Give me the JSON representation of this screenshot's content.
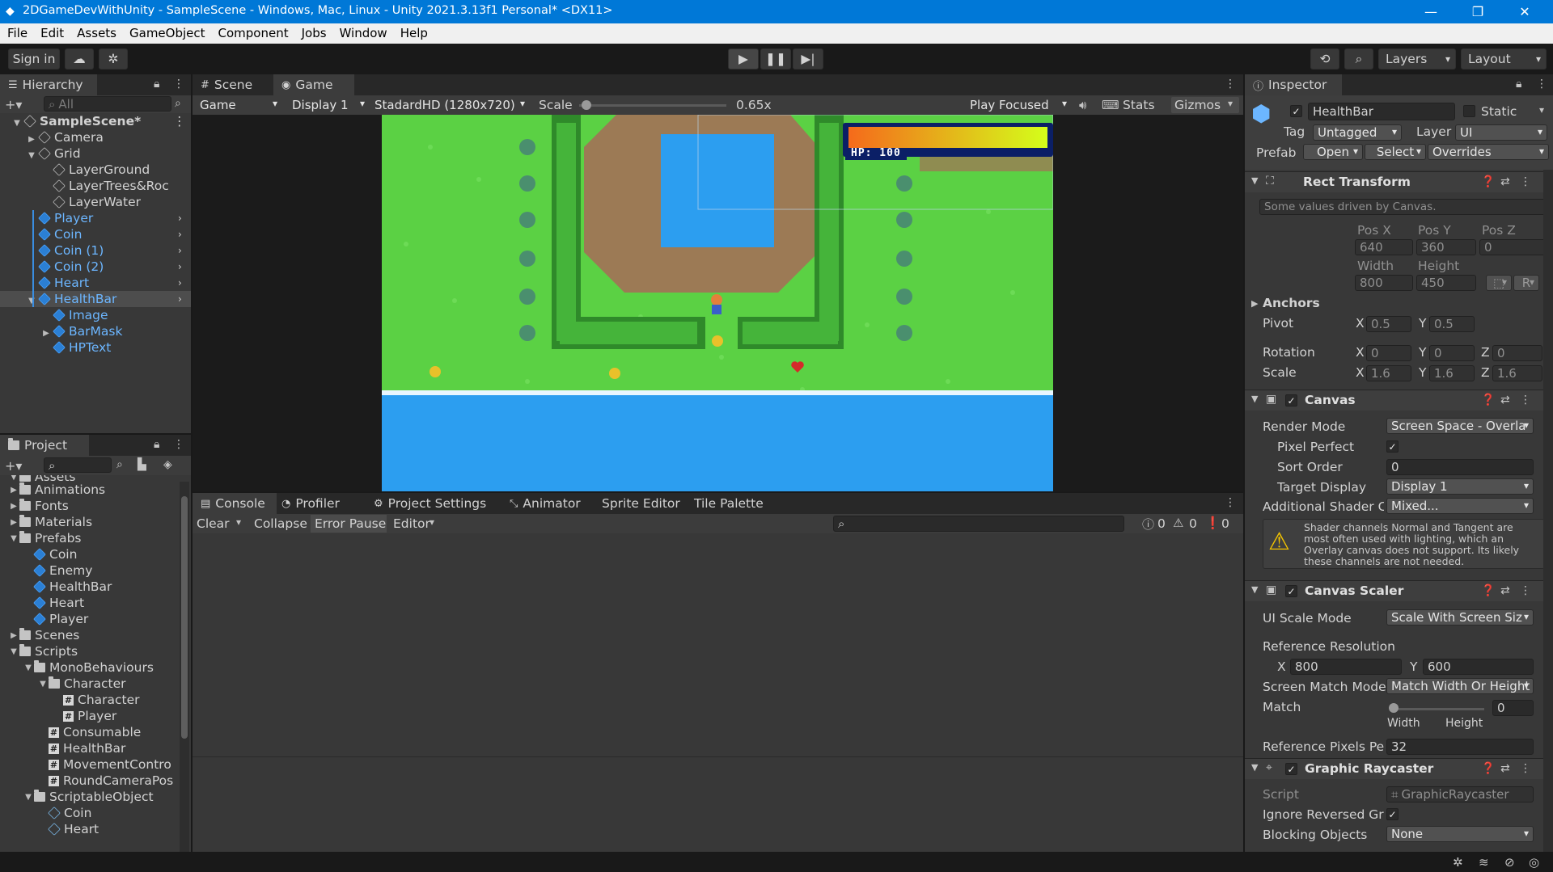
{
  "window": {
    "title": "2DGameDevWithUnity - SampleScene - Windows, Mac, Linux - Unity 2021.3.13f1 Personal* <DX11>"
  },
  "menu": [
    "File",
    "Edit",
    "Assets",
    "GameObject",
    "Component",
    "Jobs",
    "Window",
    "Help"
  ],
  "toolbar": {
    "sign_in": "Sign in",
    "layers": "Layers",
    "layout": "Layout"
  },
  "hierarchy": {
    "tab": "Hierarchy",
    "search_placeholder": "All",
    "items": [
      {
        "label": "SampleScene*",
        "depth": 0,
        "kind": "scene"
      },
      {
        "label": "Camera",
        "depth": 1,
        "kind": "obj"
      },
      {
        "label": "Grid",
        "depth": 1,
        "kind": "obj"
      },
      {
        "label": "LayerGround",
        "depth": 2,
        "kind": "obj"
      },
      {
        "label": "LayerTrees&Roc",
        "depth": 2,
        "kind": "obj"
      },
      {
        "label": "LayerWater",
        "depth": 2,
        "kind": "obj"
      },
      {
        "label": "Player",
        "depth": 1,
        "kind": "prefab"
      },
      {
        "label": "Coin",
        "depth": 1,
        "kind": "prefab"
      },
      {
        "label": "Coin (1)",
        "depth": 1,
        "kind": "prefab"
      },
      {
        "label": "Coin (2)",
        "depth": 1,
        "kind": "prefab"
      },
      {
        "label": "Heart",
        "depth": 1,
        "kind": "prefab"
      },
      {
        "label": "HealthBar",
        "depth": 1,
        "kind": "prefab-selected"
      },
      {
        "label": "Image",
        "depth": 2,
        "kind": "prefab-child"
      },
      {
        "label": "BarMask",
        "depth": 2,
        "kind": "prefab-child"
      },
      {
        "label": "HPText",
        "depth": 2,
        "kind": "prefab-child"
      }
    ]
  },
  "project": {
    "tab": "Project",
    "root": "Assets",
    "items": [
      {
        "label": "Animations",
        "depth": 1,
        "kind": "folder"
      },
      {
        "label": "Fonts",
        "depth": 1,
        "kind": "folder"
      },
      {
        "label": "Materials",
        "depth": 1,
        "kind": "folder"
      },
      {
        "label": "Prefabs",
        "depth": 1,
        "kind": "folder"
      },
      {
        "label": "Coin",
        "depth": 2,
        "kind": "prefab"
      },
      {
        "label": "Enemy",
        "depth": 2,
        "kind": "prefab"
      },
      {
        "label": "HealthBar",
        "depth": 2,
        "kind": "prefab"
      },
      {
        "label": "Heart",
        "depth": 2,
        "kind": "prefab"
      },
      {
        "label": "Player",
        "depth": 2,
        "kind": "prefab"
      },
      {
        "label": "Scenes",
        "depth": 1,
        "kind": "folder"
      },
      {
        "label": "Scripts",
        "depth": 1,
        "kind": "folder"
      },
      {
        "label": "MonoBehaviours",
        "depth": 2,
        "kind": "folder"
      },
      {
        "label": "Character",
        "depth": 3,
        "kind": "folder"
      },
      {
        "label": "Character",
        "depth": 4,
        "kind": "script"
      },
      {
        "label": "Player",
        "depth": 4,
        "kind": "script"
      },
      {
        "label": "Consumable",
        "depth": 3,
        "kind": "script"
      },
      {
        "label": "HealthBar",
        "depth": 3,
        "kind": "script"
      },
      {
        "label": "MovementContro",
        "depth": 3,
        "kind": "script"
      },
      {
        "label": "RoundCameraPos",
        "depth": 3,
        "kind": "script"
      },
      {
        "label": "ScriptableObject",
        "depth": 2,
        "kind": "folder"
      },
      {
        "label": "Coin",
        "depth": 3,
        "kind": "so"
      },
      {
        "label": "Heart",
        "depth": 3,
        "kind": "so"
      }
    ]
  },
  "game_view": {
    "tabs": [
      "Scene",
      "Game"
    ],
    "mode": "Game",
    "display": "Display 1",
    "resolution": "StadardHD (1280x720)",
    "scale_label": "Scale",
    "scale_value": "0.65x",
    "scale_fraction": 0.05,
    "play_focused": "Play Focused",
    "stats": "Stats",
    "gizmos": "Gizmos",
    "hp_text": "HP: 100"
  },
  "console": {
    "tabs": [
      "Console",
      "Profiler",
      "Project Settings",
      "Animator",
      "Sprite Editor",
      "Tile Palette"
    ],
    "clear": "Clear",
    "collapse": "Collapse",
    "error_pause": "Error Pause",
    "editor": "Editor",
    "counts": {
      "log": "0",
      "warn": "0",
      "error": "0"
    }
  },
  "inspector": {
    "tab": "Inspector",
    "object_name": "HealthBar",
    "static": "Static",
    "tag_label": "Tag",
    "tag": "Untagged",
    "layer_label": "Layer",
    "layer": "UI",
    "prefab_label": "Prefab",
    "open": "Open",
    "select": "Select",
    "overrides": "Overrides",
    "rect": {
      "title": "Rect Transform",
      "note": "Some values driven by Canvas.",
      "posx_label": "Pos X",
      "posy_label": "Pos Y",
      "posz_label": "Pos Z",
      "posx": "640",
      "posy": "360",
      "posz": "0",
      "width_label": "Width",
      "height_label": "Height",
      "width": "800",
      "height": "450",
      "anchors": "Anchors",
      "pivot": "Pivot",
      "pivot_x": "0.5",
      "pivot_y": "0.5",
      "rotation": "Rotation",
      "rot_x": "0",
      "rot_y": "0",
      "rot_z": "0",
      "scale": "Scale",
      "scale_x": "1.6",
      "scale_y": "1.6",
      "scale_z": "1.6",
      "x": "X",
      "y": "Y",
      "z": "Z",
      "r_btn": "R"
    },
    "canvas": {
      "title": "Canvas",
      "render_mode_label": "Render Mode",
      "render_mode": "Screen Space - Overla",
      "pixel_perfect": "Pixel Perfect",
      "sort_order_label": "Sort Order",
      "sort_order": "0",
      "target_display_label": "Target Display",
      "target_display": "Display 1",
      "shader_label": "Additional Shader Ch",
      "shader": "Mixed...",
      "warning": "Shader channels Normal and Tangent are most often used with lighting, which an Overlay canvas does not support. Its likely these channels are not needed."
    },
    "scaler": {
      "title": "Canvas Scaler",
      "ui_scale_label": "UI Scale Mode",
      "ui_scale": "Scale With Screen Siz",
      "ref_res": "Reference Resolution",
      "x": "X",
      "y": "Y",
      "ref_x": "800",
      "ref_y": "600",
      "match_mode_label": "Screen Match Mode",
      "match_mode": "Match Width Or Height",
      "match_label": "Match",
      "match_value": "0",
      "match_fraction": 0,
      "width": "Width",
      "height": "Height",
      "ppu_label": "Reference Pixels Per",
      "ppu": "32"
    },
    "raycaster": {
      "title": "Graphic Raycaster",
      "script_label": "Script",
      "script": "GraphicRaycaster",
      "ignore_label": "Ignore Reversed Gra",
      "blocking_label": "Blocking Objects",
      "blocking": "None"
    }
  },
  "colors": {
    "accent": "#0078d7",
    "selection": "#2c5d87",
    "grass": "#5bd144",
    "water": "#2c9ef0",
    "dirt": "#9c7a55"
  }
}
